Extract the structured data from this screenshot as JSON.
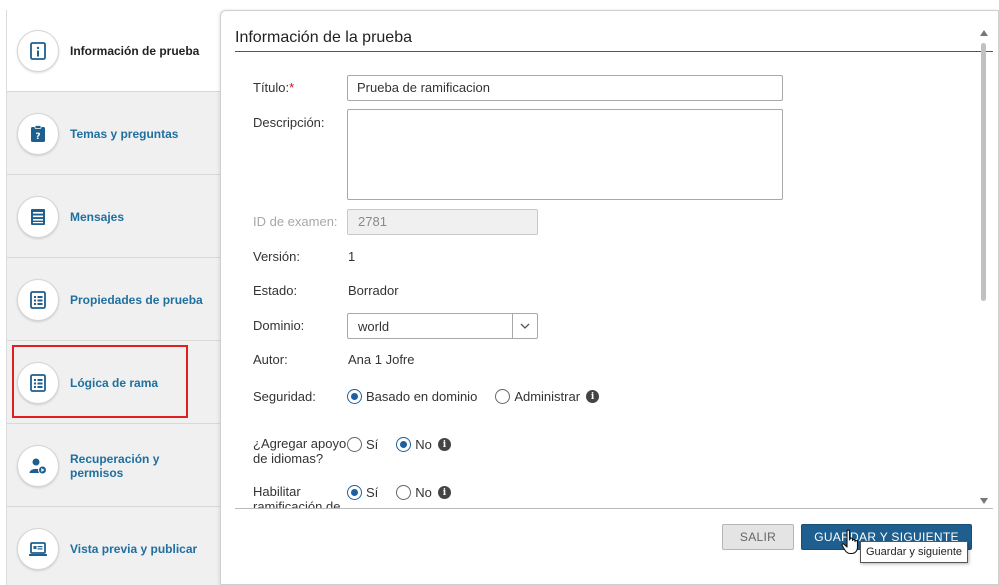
{
  "nav": {
    "items": [
      {
        "label": "Información de prueba",
        "icon": "info-document-icon"
      },
      {
        "label": "Temas y preguntas",
        "icon": "question-clipboard-icon"
      },
      {
        "label": "Mensajes",
        "icon": "message-list-icon"
      },
      {
        "label": "Propiedades de prueba",
        "icon": "properties-document-icon"
      },
      {
        "label": "Lógica de rama",
        "icon": "branch-logic-document-icon"
      },
      {
        "label": "Recuperación y permisos",
        "icon": "user-permissions-icon"
      },
      {
        "label": "Vista previa y publicar",
        "icon": "preview-laptop-icon"
      }
    ],
    "active_index": 0,
    "highlighted_index": 4
  },
  "panel": {
    "title": "Información de la prueba"
  },
  "form": {
    "title_label": "Título:",
    "title_required": "*",
    "title_value": "Prueba de ramificacion",
    "description_label": "Descripción:",
    "description_value": "",
    "exam_id_label": "ID de examen:",
    "exam_id_value": "2781",
    "version_label": "Versión:",
    "version_value": "1",
    "status_label": "Estado:",
    "status_value": "Borrador",
    "domain_label": "Dominio:",
    "domain_value": "world",
    "author_label": "Autor:",
    "author_value": "Ana 1 Jofre",
    "security_label": "Seguridad:",
    "security_options": [
      "Basado en dominio",
      "Administrar"
    ],
    "security_selected": "Basado en dominio",
    "language_label": "¿Agregar apoyo de idiomas?",
    "language_options": [
      "Sí",
      "No"
    ],
    "language_selected": "No",
    "branching_label": "Habilitar ramificación de",
    "branching_options": [
      "Sí",
      "No"
    ],
    "branching_selected": "Sí"
  },
  "buttons": {
    "exit_label": "SALIR",
    "save_label": "GUARDAR Y SIGUIENTE",
    "save_tooltip": "Guardar y siguiente"
  },
  "colors": {
    "accent": "#1e5f8f",
    "nav_text": "#1f6f9f",
    "highlight": "#e02020",
    "required": "#d01010"
  }
}
